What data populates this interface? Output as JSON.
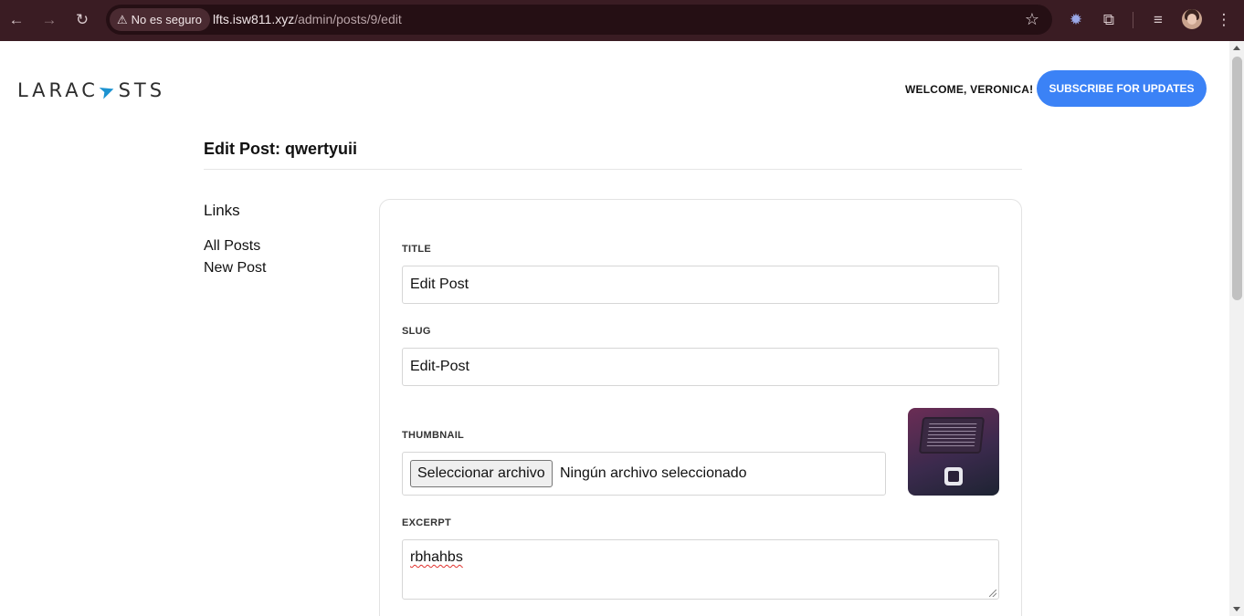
{
  "browser": {
    "security_label": "No es seguro",
    "url_host": "lfts.isw811.xyz",
    "url_path": "/admin/posts/9/edit"
  },
  "header": {
    "logo_left": "LARAC",
    "logo_right": "STS",
    "welcome": "WELCOME, VERONICA!",
    "subscribe_label": "SUBSCRIBE FOR UPDATES",
    "subscribe_color": "#3b82f6"
  },
  "main": {
    "title": "Edit Post: qwertyuii"
  },
  "sidebar": {
    "heading": "Links",
    "items": [
      {
        "label": "All Posts"
      },
      {
        "label": "New Post"
      }
    ]
  },
  "form": {
    "title_label": "TITLE",
    "title_value": "Edit Post",
    "slug_label": "SLUG",
    "slug_value": "Edit-Post",
    "thumbnail_label": "THUMBNAIL",
    "file_button_label": "Seleccionar archivo",
    "file_status": "Ningún archivo seleccionado",
    "excerpt_label": "EXCERPT",
    "excerpt_value": "rbhahbs"
  }
}
